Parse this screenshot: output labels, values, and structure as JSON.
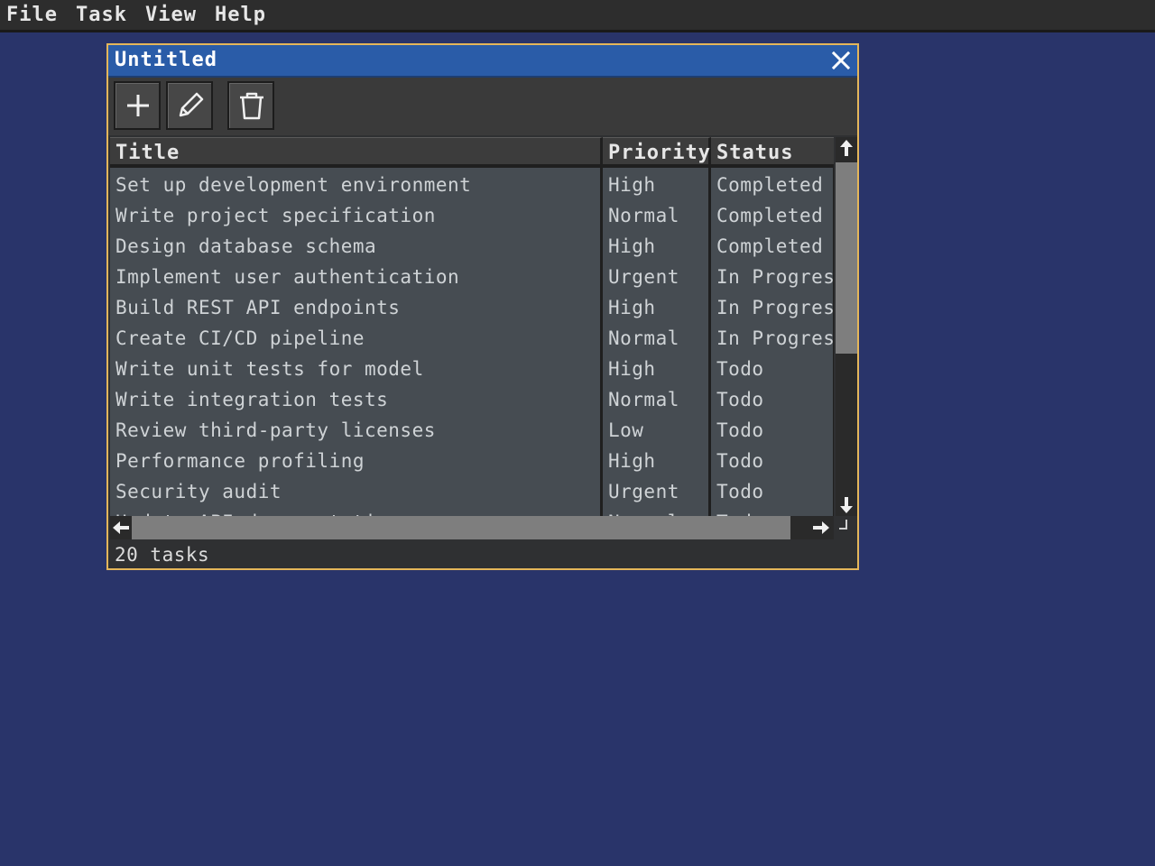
{
  "menubar": {
    "items": [
      {
        "label": "File"
      },
      {
        "label": "Task"
      },
      {
        "label": "View"
      },
      {
        "label": "Help"
      }
    ]
  },
  "window": {
    "title": "Untitled",
    "close_icon": "close-icon"
  },
  "toolbar": {
    "buttons": [
      {
        "icon": "plus-icon",
        "action": "add"
      },
      {
        "icon": "pencil-icon",
        "action": "edit"
      },
      {
        "icon": "trash-icon",
        "action": "delete"
      }
    ]
  },
  "table": {
    "columns": [
      "Title",
      "Priority",
      "Status"
    ],
    "rows": [
      {
        "title": "Set up development environment",
        "priority": "High",
        "status": "Completed"
      },
      {
        "title": "Write project specification",
        "priority": "Normal",
        "status": "Completed"
      },
      {
        "title": "Design database schema",
        "priority": "High",
        "status": "Completed"
      },
      {
        "title": "Implement user authentication",
        "priority": "Urgent",
        "status": "In Progress"
      },
      {
        "title": "Build REST API endpoints",
        "priority": "High",
        "status": "In Progress"
      },
      {
        "title": "Create CI/CD pipeline",
        "priority": "Normal",
        "status": "In Progress"
      },
      {
        "title": "Write unit tests for model",
        "priority": "High",
        "status": "Todo"
      },
      {
        "title": "Write integration tests",
        "priority": "Normal",
        "status": "Todo"
      },
      {
        "title": "Review third-party licenses",
        "priority": "Low",
        "status": "Todo"
      },
      {
        "title": "Performance profiling",
        "priority": "High",
        "status": "Todo"
      },
      {
        "title": "Security audit",
        "priority": "Urgent",
        "status": "Todo"
      },
      {
        "title": "Update API documentation",
        "priority": "Normal",
        "status": "Todo"
      }
    ]
  },
  "statusbar": {
    "text": "20 tasks"
  },
  "colors": {
    "desktop": "#29346a",
    "titlebar": "#2a5ca8",
    "window_border": "#e4b65a",
    "row_bg": "#464c52"
  }
}
